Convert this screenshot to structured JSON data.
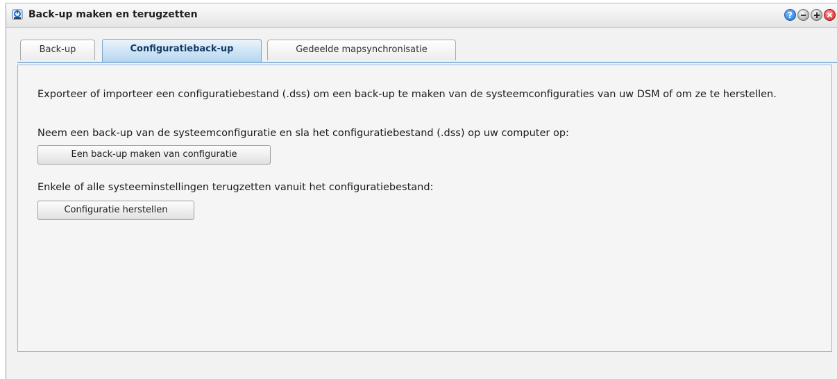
{
  "window": {
    "title": "Back-up maken en terugzetten",
    "app_icon": "backup-restore-icon",
    "controls": {
      "help_icon": "help-icon",
      "minimize_icon": "minimize-icon",
      "maximize_icon": "maximize-icon",
      "close_icon": "close-icon",
      "help_glyph": "?"
    }
  },
  "tabs": [
    {
      "label": "Back-up",
      "active": false
    },
    {
      "label": "Configuratieback-up",
      "active": true
    },
    {
      "label": "Gedeelde mapsynchronisatie",
      "active": false
    }
  ],
  "content": {
    "intro": "Exporteer of importeer een configuratiebestand (.dss) om een back-up te maken van de systeemconfiguraties van uw DSM of om ze te herstellen.",
    "backup_text": "Neem een back-up van de systeemconfiguratie en sla het configuratiebestand (.dss) op uw computer op:",
    "backup_button": "Een back-up maken van configuratie",
    "restore_text": "Enkele of alle systeeminstellingen terugzetten vanuit het configuratiebestand:",
    "restore_button": "Configuratie herstellen"
  },
  "colors": {
    "active_tab": "#b6d6ef",
    "panel_border": "#8eb8dd",
    "close": "#d51e1e",
    "help": "#1c6fd1"
  }
}
